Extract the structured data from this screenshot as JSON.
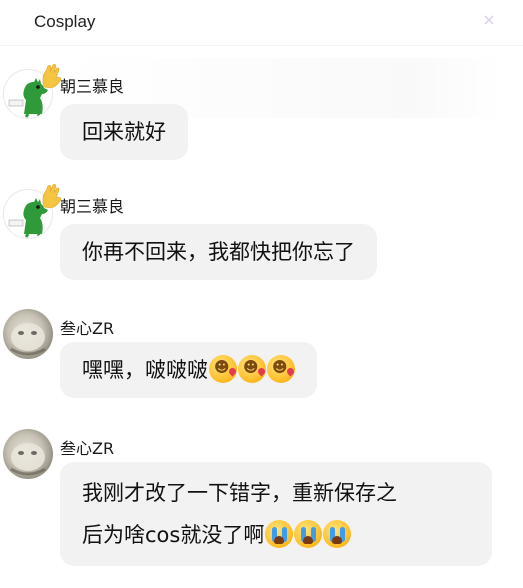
{
  "header": {
    "title": "Cosplay",
    "close_label": "×"
  },
  "messages": [
    {
      "sender": "朝三慕良",
      "avatar": "dinosaur-avatar",
      "text": "回来就好",
      "emojis": []
    },
    {
      "sender": "朝三慕良",
      "avatar": "dinosaur-avatar",
      "text": "你再不回来，我都快把你忘了",
      "emojis": []
    },
    {
      "sender": "叁心ZR",
      "avatar": "cat-avatar",
      "text": "嘿嘿，啵啵啵",
      "emojis": [
        "face-blowing-kiss",
        "face-blowing-kiss",
        "face-blowing-kiss"
      ]
    },
    {
      "sender": "叁心ZR",
      "avatar": "cat-avatar",
      "text_line1": "我刚才改了一下错字，重新保存之",
      "text_line2": "后为啥cos就没了啊",
      "emojis": [
        "loudly-crying-face",
        "loudly-crying-face",
        "loudly-crying-face"
      ]
    }
  ],
  "colors": {
    "bubble": "#f2f2f2",
    "background": "#ffffff",
    "close_icon": "#d9cfe6",
    "crown": "#f5c542"
  }
}
